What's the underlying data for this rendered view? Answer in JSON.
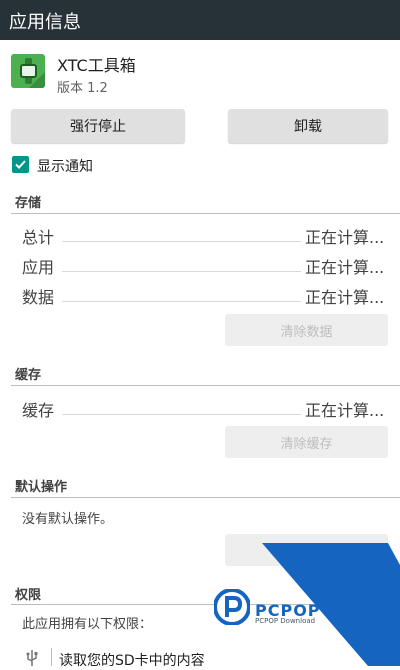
{
  "header": {
    "title": "应用信息"
  },
  "app": {
    "name": "XTC工具箱",
    "version": "版本 1.2"
  },
  "actions": {
    "force_stop": "强行停止",
    "uninstall": "卸载"
  },
  "notifications": {
    "label": "显示通知",
    "checked": true
  },
  "storage": {
    "title": "存储",
    "rows": [
      {
        "label": "总计",
        "value": "正在计算..."
      },
      {
        "label": "应用",
        "value": "正在计算..."
      },
      {
        "label": "数据",
        "value": "正在计算..."
      }
    ],
    "clear_button": "清除数据"
  },
  "cache": {
    "title": "缓存",
    "rows": [
      {
        "label": "缓存",
        "value": "正在计算..."
      }
    ],
    "clear_button": "清除缓存"
  },
  "defaults": {
    "title": "默认操作",
    "text": "没有默认操作。"
  },
  "permissions": {
    "title": "权限",
    "intro": "此应用拥有以下权限：",
    "items": [
      {
        "icon": "usb-icon",
        "label": "读取您的SD卡中的内容"
      }
    ]
  },
  "watermark": {
    "brand": "PCPOP下载",
    "sub": "PCPOP Download"
  },
  "colors": {
    "topbar": "#263238",
    "accent": "#009688",
    "watermark_blue": "#1565c0"
  }
}
